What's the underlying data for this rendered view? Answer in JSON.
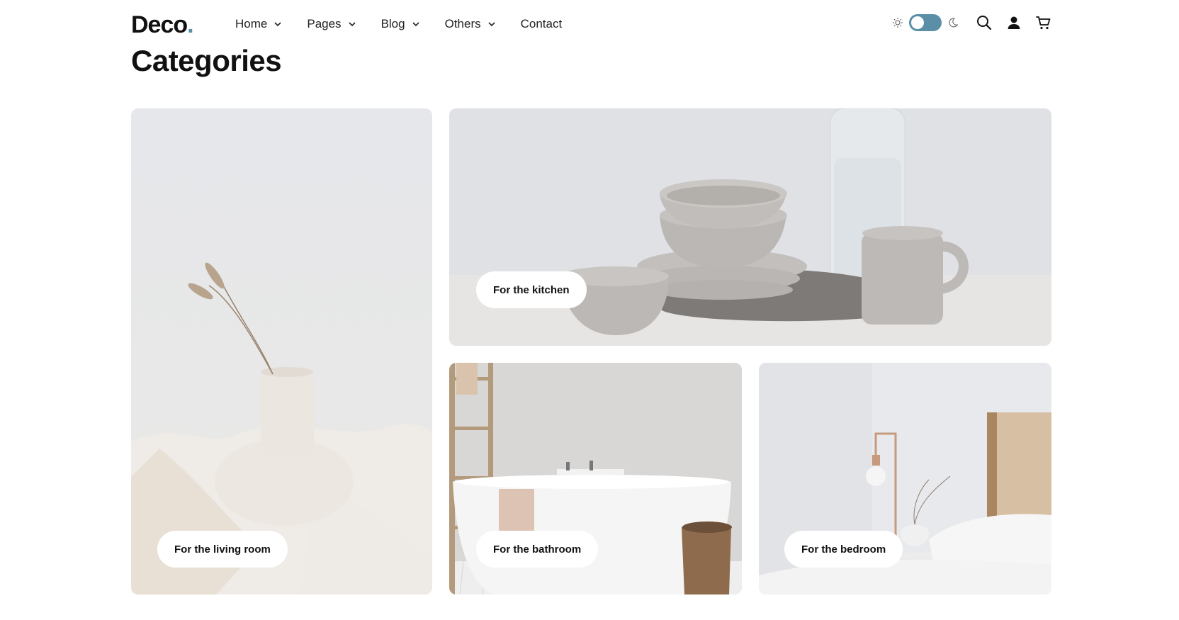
{
  "brand": {
    "name": "Deco",
    "dot": ".",
    "dot_color": "#5b8fa8"
  },
  "nav": {
    "items": [
      {
        "label": "Home",
        "has_dropdown": true
      },
      {
        "label": "Pages",
        "has_dropdown": true
      },
      {
        "label": "Blog",
        "has_dropdown": true
      },
      {
        "label": "Others",
        "has_dropdown": true
      },
      {
        "label": "Contact",
        "has_dropdown": false
      }
    ]
  },
  "tools": {
    "theme_toggle_state": "light",
    "icons": [
      "sun-icon",
      "moon-icon",
      "search-icon",
      "user-icon",
      "cart-icon"
    ],
    "accent_color": "#5b8fa8"
  },
  "page": {
    "title": "Categories"
  },
  "categories": [
    {
      "label": "For the living room"
    },
    {
      "label": "For the kitchen"
    },
    {
      "label": "For the bathroom"
    },
    {
      "label": "For the bedroom"
    }
  ]
}
